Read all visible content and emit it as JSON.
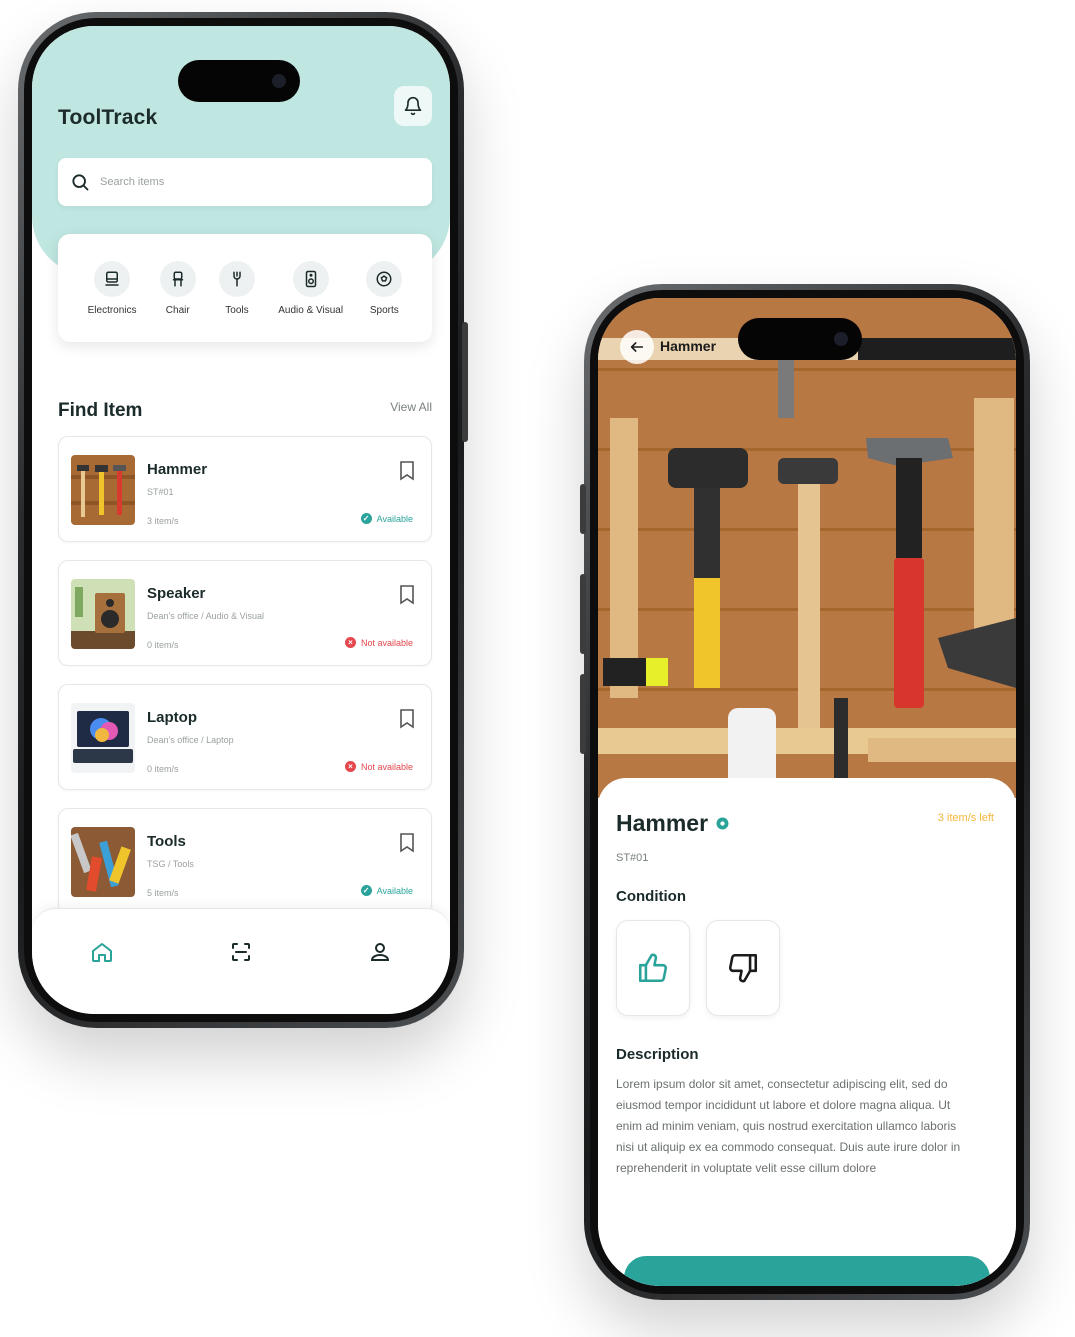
{
  "home": {
    "app_title": "ToolTrack",
    "search_placeholder": "Search items",
    "categories": [
      {
        "label": "Electronics",
        "icon": "monitor-icon"
      },
      {
        "label": "Chair",
        "icon": "chair-icon"
      },
      {
        "label": "Tools",
        "icon": "wrench-icon"
      },
      {
        "label": "Audio & Visual",
        "icon": "speaker-icon"
      },
      {
        "label": "Sports",
        "icon": "ball-icon"
      }
    ],
    "section_title": "Find Item",
    "view_all": "View All",
    "items": [
      {
        "name": "Hammer",
        "location": "ST#01",
        "count": "3 item/s",
        "status": "Available",
        "available": true
      },
      {
        "name": "Speaker",
        "location": "Dean's office / Audio & Visual",
        "count": "0 item/s",
        "status": "Not available",
        "available": false
      },
      {
        "name": "Laptop",
        "location": "Dean's office / Laptop",
        "count": "0 item/s",
        "status": "Not available",
        "available": false
      },
      {
        "name": "Tools",
        "location": "TSG / Tools",
        "count": "5 item/s",
        "status": "Available",
        "available": true
      }
    ],
    "nav": [
      "home-icon",
      "scan-icon",
      "profile-icon"
    ]
  },
  "detail": {
    "header_title": "Hammer",
    "name": "Hammer",
    "items_left": "3 item/s left",
    "code": "ST#01",
    "condition_title": "Condition",
    "description_title": "Description",
    "description": "Lorem ipsum dolor sit amet, consectetur adipiscing elit, sed do eiusmod tempor incididunt ut labore et dolore magna aliqua. Ut enim ad minim veniam, quis nostrud exercitation ullamco laboris nisi ut aliquip ex ea commodo consequat. Duis aute irure dolor in reprehenderit in voluptate velit esse cillum dolore"
  },
  "colors": {
    "teal": "#2aa39a",
    "teal_light": "#bfe6e1",
    "danger": "#e4484e",
    "warning": "#f3b63a"
  }
}
